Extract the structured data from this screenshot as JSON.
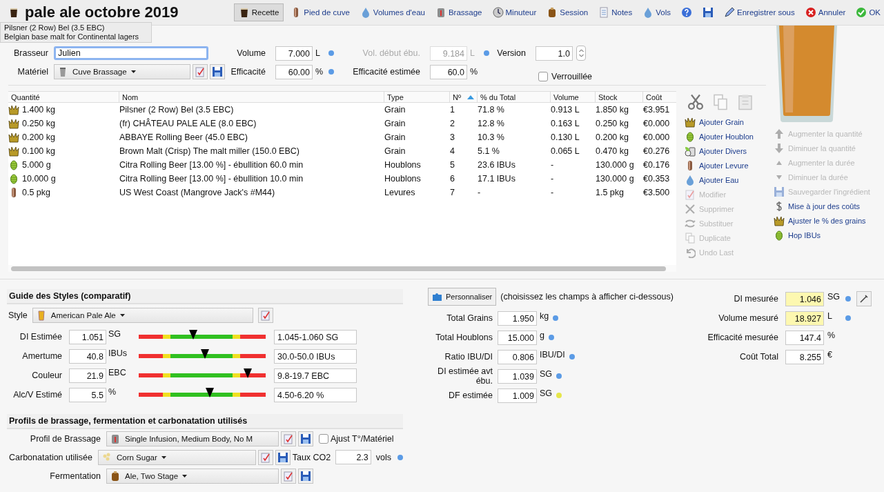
{
  "window": {
    "title": "pale ale octobre 2019"
  },
  "tooltip": {
    "lines": [
      "Pilsner (2 Row) Bel (3.5 EBC)",
      "Belgian base malt for Continental lagers"
    ]
  },
  "toolbar_left": [
    {
      "label": "Recette",
      "selected": true
    },
    {
      "label": "Pied de cuve",
      "selected": false
    },
    {
      "label": "Volumes d'eau",
      "selected": false
    },
    {
      "label": "Brassage",
      "selected": false
    },
    {
      "label": "Minuteur",
      "selected": false
    },
    {
      "label": "Session",
      "selected": false
    },
    {
      "label": "Notes",
      "selected": false
    },
    {
      "label": "Vols",
      "selected": false
    }
  ],
  "toolbar_right": [
    {
      "label": "Enregistrer sous"
    },
    {
      "label": "Annuler"
    },
    {
      "label": "OK"
    }
  ],
  "brewer": {
    "label": "Brasseur",
    "value": "Julien"
  },
  "equipment": {
    "label": "Matériel",
    "value": "Cuve Brassage"
  },
  "volume": {
    "label": "Volume",
    "value": "7.000",
    "unit": "L",
    "color": "#5b9be6",
    "disabled": false
  },
  "boil_volume": {
    "label": "Vol. début ébu.",
    "value": "9.184",
    "unit": "L",
    "color": "#5b9be6",
    "disabled": true
  },
  "efficiency": {
    "label": "Efficacité",
    "value": "60.00",
    "unit": "%",
    "color": "#5b9be6",
    "disabled": false
  },
  "estimated_efficiency": {
    "label": "Efficacité estimée",
    "value": "60.0",
    "unit": "%",
    "disabled": false
  },
  "version": {
    "label": "Version",
    "value": "1.0"
  },
  "locked": {
    "label": "Verrouillée",
    "checked": false
  },
  "table": {
    "columns": [
      {
        "label": "Quantité",
        "sorted": false
      },
      {
        "label": "Nom",
        "sorted": false
      },
      {
        "label": "Type",
        "sorted": false
      },
      {
        "label": "Nº",
        "sorted": true
      },
      {
        "label": "% du Total",
        "sorted": false
      },
      {
        "label": "Volume",
        "sorted": false
      },
      {
        "label": "Stock",
        "sorted": false
      },
      {
        "label": "Coût",
        "sorted": false
      }
    ],
    "rows": [
      {
        "kind": "grain",
        "cells": [
          "1.400 kg",
          "Pilsner (2 Row) Bel (3.5 EBC)",
          "Grain",
          "1",
          "71.8 %",
          "0.913 L",
          "1.850 kg",
          "€3.951"
        ]
      },
      {
        "kind": "grain",
        "cells": [
          "0.250 kg",
          "(fr) CHÂTEAU PALE ALE (8.0 EBC)",
          "Grain",
          "2",
          "12.8 %",
          "0.163 L",
          "0.250 kg",
          "€0.000"
        ]
      },
      {
        "kind": "grain",
        "cells": [
          "0.200 kg",
          "ABBAYE Rolling Beer (45.0 EBC)",
          "Grain",
          "3",
          "10.3 %",
          "0.130 L",
          "0.200 kg",
          "€0.000"
        ]
      },
      {
        "kind": "grain",
        "cells": [
          "0.100 kg",
          "Brown Malt (Crisp) The malt miller (150.0 EBC)",
          "Grain",
          "4",
          "5.1 %",
          "0.065 L",
          "0.470 kg",
          "€0.276"
        ]
      },
      {
        "kind": "hop",
        "cells": [
          "5.000 g",
          "Citra Rolling Beer [13.00 %] - ébullition 60.0 min",
          "Houblons",
          "5",
          "23.6 IBUs",
          "-",
          "130.000 g",
          "€0.176"
        ]
      },
      {
        "kind": "hop",
        "cells": [
          "10.000 g",
          "Citra Rolling Beer [13.00 %] - ébullition 10.0 min",
          "Houblons",
          "6",
          "17.1 IBUs",
          "-",
          "130.000 g",
          "€0.353"
        ]
      },
      {
        "kind": "yeast",
        "cells": [
          "0.5 pkg",
          "US West Coast (Mangrove Jack's #M44)",
          "Levures",
          "7",
          "-",
          "-",
          "1.5 pkg",
          "€3.500"
        ]
      }
    ]
  },
  "actions": [
    {
      "label": "Ajouter Grain",
      "disabled": false
    },
    {
      "label": "Ajouter Houblon",
      "disabled": false
    },
    {
      "label": "Ajouter Divers",
      "disabled": false
    },
    {
      "label": "Ajouter Levure",
      "disabled": false
    },
    {
      "label": "Ajouter Eau",
      "disabled": false
    },
    {
      "label": "Modifier",
      "disabled": true
    },
    {
      "label": "Supprimer",
      "disabled": true
    },
    {
      "label": "Substituer",
      "disabled": true
    },
    {
      "label": "Duplicate",
      "disabled": true
    },
    {
      "label": "Undo Last",
      "disabled": true
    }
  ],
  "actions_2": [
    {
      "label": "Augmenter la quantité",
      "disabled": true
    },
    {
      "label": "Diminuer la quantité",
      "disabled": true
    },
    {
      "label": "Augmenter la durée",
      "disabled": true
    },
    {
      "label": "Diminuer la durée",
      "disabled": true
    },
    {
      "label": "Sauvegarder l'ingrédient",
      "disabled": true
    },
    {
      "label": "Mise à jour des coûts",
      "disabled": false
    },
    {
      "label": "Ajuster le % des grains",
      "disabled": false
    },
    {
      "label": "Hop IBUs",
      "disabled": false
    }
  ],
  "style_guide": {
    "title": "Guide des Styles (comparatif)",
    "style_label": "Style",
    "style": "American Pale Ale",
    "rows": [
      {
        "label": "DI Estimée",
        "value": "1.051",
        "unit": "SG",
        "level": 0.43,
        "range": "1.045-1.060 SG"
      },
      {
        "label": "Amertume",
        "value": "40.8",
        "unit": "IBUs",
        "level": 0.52,
        "range": "30.0-50.0 IBUs"
      },
      {
        "label": "Couleur",
        "value": "21.9",
        "unit": "EBC",
        "level": 0.86,
        "range": "9.8-19.7 EBC"
      },
      {
        "label": "Alc/V Estimé",
        "value": "5.5",
        "unit": "%",
        "level": 0.56,
        "range": "4.50-6.20 %"
      }
    ]
  },
  "profiles": {
    "title": "Profils de brassage, fermentation et carbonatation utilisés",
    "mash": {
      "label": "Profil de Brassage",
      "value": "Single Infusion, Medium Body, No M"
    },
    "adjust": {
      "label": "Ajust T°/Matériel",
      "checked": false
    },
    "carbonation": {
      "label": "Carbonatation utilisée",
      "value": "Corn Sugar"
    },
    "co2": {
      "label": "Taux CO2",
      "value": "2.3",
      "unit": "vols",
      "color": "#5b9be6"
    },
    "fermentation": {
      "label": "Fermentation",
      "value": "Ale, Two Stage"
    }
  },
  "stats": {
    "button": "Personnaliser",
    "hint": "(choisissez les champs à afficher ci-dessous)",
    "rows": [
      {
        "label": "Total Grains",
        "value": "1.950",
        "unit": "kg",
        "color": "#5b9be6"
      },
      {
        "label": "Total Houblons",
        "value": "15.000",
        "unit": "g",
        "color": "#5b9be6"
      },
      {
        "label": "Ratio IBU/DI",
        "value": "0.806",
        "unit": "IBU/DI",
        "color": "#5b9be6"
      },
      {
        "label": "DI estimée avt ébu.",
        "value": "1.039",
        "unit": "SG",
        "color": "#5b9be6"
      },
      {
        "label": "DF estimée",
        "value": "1.009",
        "unit": "SG",
        "color": "#e6e64a"
      }
    ]
  },
  "measured": [
    {
      "label": "DI mesurée",
      "value": "1.046",
      "unit": "SG",
      "color": "#5b9be6",
      "highlighted": true
    },
    {
      "label": "Volume mesuré",
      "value": "18.927",
      "unit": "L",
      "color": "#5b9be6",
      "highlighted": true
    },
    {
      "label": "Efficacité mesurée",
      "value": "147.4",
      "unit": "%",
      "highlighted": false
    },
    {
      "label": "Coût Total",
      "value": "8.255",
      "unit": "€",
      "highlighted": false
    }
  ]
}
